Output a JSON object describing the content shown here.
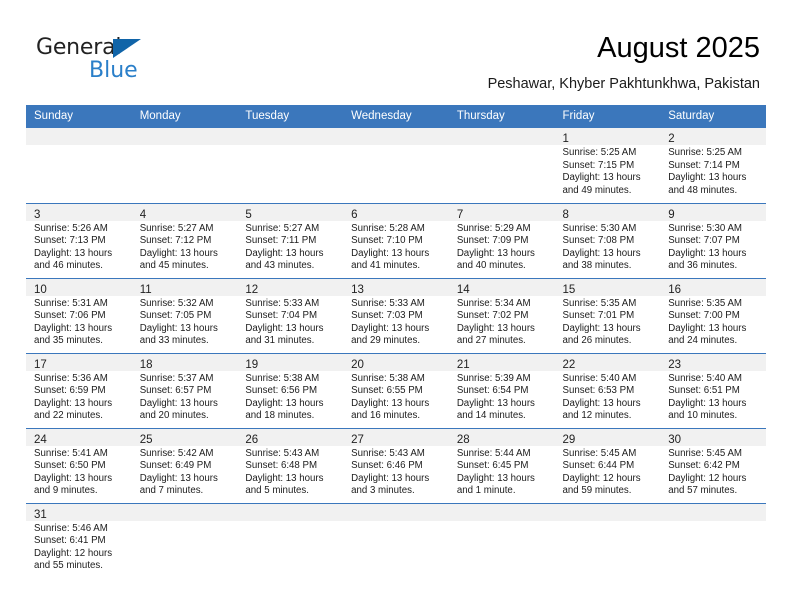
{
  "brand": {
    "name_dark": "General",
    "name_blue": "Blue",
    "accent_color": "#1064a8",
    "blue_text_color": "#2a7fc9"
  },
  "header": {
    "title": "August 2025",
    "subtitle": "Peshawar, Khyber Pakhtunkhwa, Pakistan",
    "header_bg_color": "#3b77bc",
    "daynum_band_color": "#f1f1f1"
  },
  "calendar": {
    "weekday_headers": [
      "Sunday",
      "Monday",
      "Tuesday",
      "Wednesday",
      "Thursday",
      "Friday",
      "Saturday"
    ],
    "weeks": [
      [
        {
          "day": "",
          "sunrise": "",
          "sunset": "",
          "daylight_line1": "",
          "daylight_line2": ""
        },
        {
          "day": "",
          "sunrise": "",
          "sunset": "",
          "daylight_line1": "",
          "daylight_line2": ""
        },
        {
          "day": "",
          "sunrise": "",
          "sunset": "",
          "daylight_line1": "",
          "daylight_line2": ""
        },
        {
          "day": "",
          "sunrise": "",
          "sunset": "",
          "daylight_line1": "",
          "daylight_line2": ""
        },
        {
          "day": "",
          "sunrise": "",
          "sunset": "",
          "daylight_line1": "",
          "daylight_line2": ""
        },
        {
          "day": "1",
          "sunrise": "Sunrise: 5:25 AM",
          "sunset": "Sunset: 7:15 PM",
          "daylight_line1": "Daylight: 13 hours",
          "daylight_line2": "and 49 minutes."
        },
        {
          "day": "2",
          "sunrise": "Sunrise: 5:25 AM",
          "sunset": "Sunset: 7:14 PM",
          "daylight_line1": "Daylight: 13 hours",
          "daylight_line2": "and 48 minutes."
        }
      ],
      [
        {
          "day": "3",
          "sunrise": "Sunrise: 5:26 AM",
          "sunset": "Sunset: 7:13 PM",
          "daylight_line1": "Daylight: 13 hours",
          "daylight_line2": "and 46 minutes."
        },
        {
          "day": "4",
          "sunrise": "Sunrise: 5:27 AM",
          "sunset": "Sunset: 7:12 PM",
          "daylight_line1": "Daylight: 13 hours",
          "daylight_line2": "and 45 minutes."
        },
        {
          "day": "5",
          "sunrise": "Sunrise: 5:27 AM",
          "sunset": "Sunset: 7:11 PM",
          "daylight_line1": "Daylight: 13 hours",
          "daylight_line2": "and 43 minutes."
        },
        {
          "day": "6",
          "sunrise": "Sunrise: 5:28 AM",
          "sunset": "Sunset: 7:10 PM",
          "daylight_line1": "Daylight: 13 hours",
          "daylight_line2": "and 41 minutes."
        },
        {
          "day": "7",
          "sunrise": "Sunrise: 5:29 AM",
          "sunset": "Sunset: 7:09 PM",
          "daylight_line1": "Daylight: 13 hours",
          "daylight_line2": "and 40 minutes."
        },
        {
          "day": "8",
          "sunrise": "Sunrise: 5:30 AM",
          "sunset": "Sunset: 7:08 PM",
          "daylight_line1": "Daylight: 13 hours",
          "daylight_line2": "and 38 minutes."
        },
        {
          "day": "9",
          "sunrise": "Sunrise: 5:30 AM",
          "sunset": "Sunset: 7:07 PM",
          "daylight_line1": "Daylight: 13 hours",
          "daylight_line2": "and 36 minutes."
        }
      ],
      [
        {
          "day": "10",
          "sunrise": "Sunrise: 5:31 AM",
          "sunset": "Sunset: 7:06 PM",
          "daylight_line1": "Daylight: 13 hours",
          "daylight_line2": "and 35 minutes."
        },
        {
          "day": "11",
          "sunrise": "Sunrise: 5:32 AM",
          "sunset": "Sunset: 7:05 PM",
          "daylight_line1": "Daylight: 13 hours",
          "daylight_line2": "and 33 minutes."
        },
        {
          "day": "12",
          "sunrise": "Sunrise: 5:33 AM",
          "sunset": "Sunset: 7:04 PM",
          "daylight_line1": "Daylight: 13 hours",
          "daylight_line2": "and 31 minutes."
        },
        {
          "day": "13",
          "sunrise": "Sunrise: 5:33 AM",
          "sunset": "Sunset: 7:03 PM",
          "daylight_line1": "Daylight: 13 hours",
          "daylight_line2": "and 29 minutes."
        },
        {
          "day": "14",
          "sunrise": "Sunrise: 5:34 AM",
          "sunset": "Sunset: 7:02 PM",
          "daylight_line1": "Daylight: 13 hours",
          "daylight_line2": "and 27 minutes."
        },
        {
          "day": "15",
          "sunrise": "Sunrise: 5:35 AM",
          "sunset": "Sunset: 7:01 PM",
          "daylight_line1": "Daylight: 13 hours",
          "daylight_line2": "and 26 minutes."
        },
        {
          "day": "16",
          "sunrise": "Sunrise: 5:35 AM",
          "sunset": "Sunset: 7:00 PM",
          "daylight_line1": "Daylight: 13 hours",
          "daylight_line2": "and 24 minutes."
        }
      ],
      [
        {
          "day": "17",
          "sunrise": "Sunrise: 5:36 AM",
          "sunset": "Sunset: 6:59 PM",
          "daylight_line1": "Daylight: 13 hours",
          "daylight_line2": "and 22 minutes."
        },
        {
          "day": "18",
          "sunrise": "Sunrise: 5:37 AM",
          "sunset": "Sunset: 6:57 PM",
          "daylight_line1": "Daylight: 13 hours",
          "daylight_line2": "and 20 minutes."
        },
        {
          "day": "19",
          "sunrise": "Sunrise: 5:38 AM",
          "sunset": "Sunset: 6:56 PM",
          "daylight_line1": "Daylight: 13 hours",
          "daylight_line2": "and 18 minutes."
        },
        {
          "day": "20",
          "sunrise": "Sunrise: 5:38 AM",
          "sunset": "Sunset: 6:55 PM",
          "daylight_line1": "Daylight: 13 hours",
          "daylight_line2": "and 16 minutes."
        },
        {
          "day": "21",
          "sunrise": "Sunrise: 5:39 AM",
          "sunset": "Sunset: 6:54 PM",
          "daylight_line1": "Daylight: 13 hours",
          "daylight_line2": "and 14 minutes."
        },
        {
          "day": "22",
          "sunrise": "Sunrise: 5:40 AM",
          "sunset": "Sunset: 6:53 PM",
          "daylight_line1": "Daylight: 13 hours",
          "daylight_line2": "and 12 minutes."
        },
        {
          "day": "23",
          "sunrise": "Sunrise: 5:40 AM",
          "sunset": "Sunset: 6:51 PM",
          "daylight_line1": "Daylight: 13 hours",
          "daylight_line2": "and 10 minutes."
        }
      ],
      [
        {
          "day": "24",
          "sunrise": "Sunrise: 5:41 AM",
          "sunset": "Sunset: 6:50 PM",
          "daylight_line1": "Daylight: 13 hours",
          "daylight_line2": "and 9 minutes."
        },
        {
          "day": "25",
          "sunrise": "Sunrise: 5:42 AM",
          "sunset": "Sunset: 6:49 PM",
          "daylight_line1": "Daylight: 13 hours",
          "daylight_line2": "and 7 minutes."
        },
        {
          "day": "26",
          "sunrise": "Sunrise: 5:43 AM",
          "sunset": "Sunset: 6:48 PM",
          "daylight_line1": "Daylight: 13 hours",
          "daylight_line2": "and 5 minutes."
        },
        {
          "day": "27",
          "sunrise": "Sunrise: 5:43 AM",
          "sunset": "Sunset: 6:46 PM",
          "daylight_line1": "Daylight: 13 hours",
          "daylight_line2": "and 3 minutes."
        },
        {
          "day": "28",
          "sunrise": "Sunrise: 5:44 AM",
          "sunset": "Sunset: 6:45 PM",
          "daylight_line1": "Daylight: 13 hours",
          "daylight_line2": "and 1 minute."
        },
        {
          "day": "29",
          "sunrise": "Sunrise: 5:45 AM",
          "sunset": "Sunset: 6:44 PM",
          "daylight_line1": "Daylight: 12 hours",
          "daylight_line2": "and 59 minutes."
        },
        {
          "day": "30",
          "sunrise": "Sunrise: 5:45 AM",
          "sunset": "Sunset: 6:42 PM",
          "daylight_line1": "Daylight: 12 hours",
          "daylight_line2": "and 57 minutes."
        }
      ],
      [
        {
          "day": "31",
          "sunrise": "Sunrise: 5:46 AM",
          "sunset": "Sunset: 6:41 PM",
          "daylight_line1": "Daylight: 12 hours",
          "daylight_line2": "and 55 minutes."
        },
        {
          "day": "",
          "sunrise": "",
          "sunset": "",
          "daylight_line1": "",
          "daylight_line2": ""
        },
        {
          "day": "",
          "sunrise": "",
          "sunset": "",
          "daylight_line1": "",
          "daylight_line2": ""
        },
        {
          "day": "",
          "sunrise": "",
          "sunset": "",
          "daylight_line1": "",
          "daylight_line2": ""
        },
        {
          "day": "",
          "sunrise": "",
          "sunset": "",
          "daylight_line1": "",
          "daylight_line2": ""
        },
        {
          "day": "",
          "sunrise": "",
          "sunset": "",
          "daylight_line1": "",
          "daylight_line2": ""
        },
        {
          "day": "",
          "sunrise": "",
          "sunset": "",
          "daylight_line1": "",
          "daylight_line2": ""
        }
      ]
    ]
  }
}
